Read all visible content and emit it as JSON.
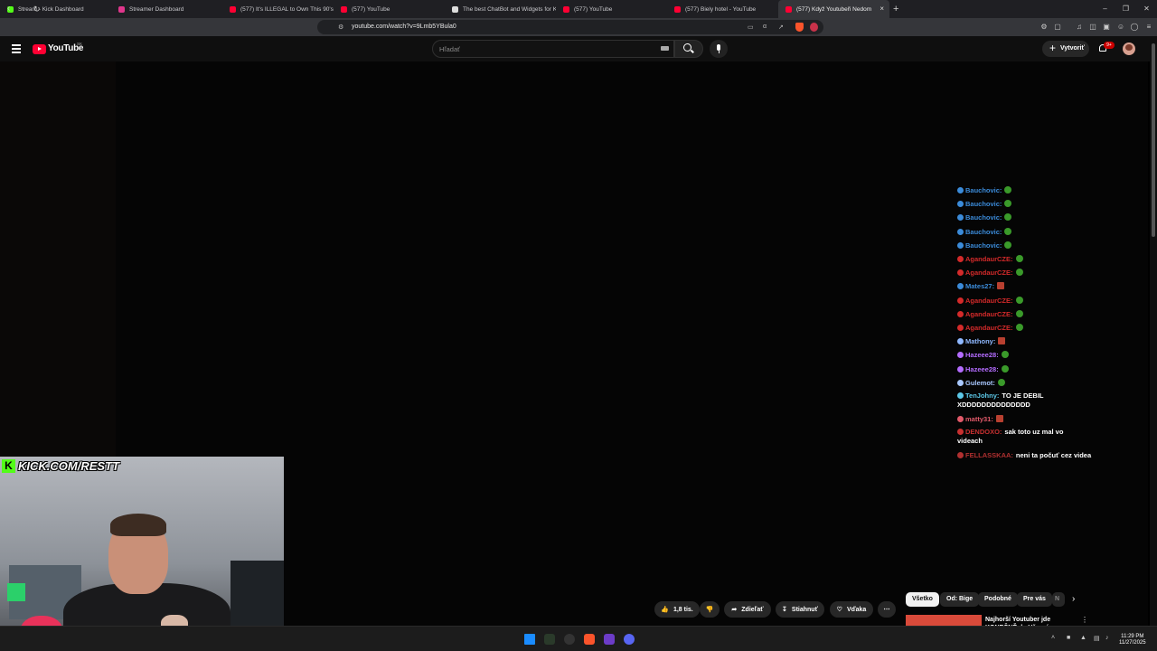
{
  "browser": {
    "tabs": [
      {
        "title": "Stream - Kick Dashboard",
        "color": "#53fc18"
      },
      {
        "title": "Streamer Dashboard",
        "color": "#e0368c"
      },
      {
        "title": "(577) It's ILLEGAL to Own This 90's H",
        "color": "#ff0033"
      },
      {
        "title": "(577) YouTube",
        "color": "#ff0033"
      },
      {
        "title": "The best ChatBot and Widgets for K",
        "color": "#dddddd"
      },
      {
        "title": "(577) YouTube",
        "color": "#ff0033"
      },
      {
        "title": "(577) Biely hotel - YouTube",
        "color": "#ff0033"
      },
      {
        "title": "(577) Když Youtubeři Nedom",
        "color": "#ff0033",
        "active": true
      }
    ],
    "url": "youtube.com/watch?v=9Lmb5YBula0"
  },
  "youtube": {
    "logo_text": "YouTube",
    "country": "SK",
    "search_placeholder": "Hľadať",
    "create_label": "Vytvoriť",
    "notif_count": "9+"
  },
  "chat": [
    {
      "user": "Bauchovic:",
      "color": "#3b8bd9",
      "text": "",
      "emote": true
    },
    {
      "user": "Bauchovic:",
      "color": "#3b8bd9",
      "text": "",
      "emote": true
    },
    {
      "user": "Bauchovic:",
      "color": "#3b8bd9",
      "text": "",
      "emote": true
    },
    {
      "user": "Bauchovic:",
      "color": "#3b8bd9",
      "text": "",
      "emote": true
    },
    {
      "user": "Bauchovic:",
      "color": "#3b8bd9",
      "text": "",
      "emote": true
    },
    {
      "user": "AgandaurCZE:",
      "color": "#d42a2a",
      "text": "",
      "emote": true
    },
    {
      "user": "AgandaurCZE:",
      "color": "#d42a2a",
      "text": "",
      "emote": true
    },
    {
      "user": "Mates27:",
      "color": "#3b8bd9",
      "text": "",
      "emote": true
    },
    {
      "user": "AgandaurCZE:",
      "color": "#d42a2a",
      "text": "",
      "emote": true
    },
    {
      "user": "AgandaurCZE:",
      "color": "#d42a2a",
      "text": "",
      "emote": true
    },
    {
      "user": "AgandaurCZE:",
      "color": "#d42a2a",
      "text": "",
      "emote": true
    },
    {
      "user": "Mathony:",
      "color": "#8fb8ff",
      "text": "",
      "emote": true
    },
    {
      "user": "Hazeee28:",
      "color": "#b46cff",
      "text": "",
      "emote": true
    },
    {
      "user": "Hazeee28:",
      "color": "#b46cff",
      "text": "",
      "emote": true
    },
    {
      "user": "Gulemot:",
      "color": "#a9c8ff",
      "text": "",
      "emote": true
    },
    {
      "user": "TenJohny:",
      "color": "#5cc8e8",
      "text": "TO JE DEBIL XDDDDDDDDDDDDDD",
      "emote": false
    },
    {
      "user": "matty31:",
      "color": "#e25a6a",
      "text": "",
      "emote": true
    },
    {
      "user": "DENDOXO:",
      "color": "#c83030",
      "text": "sak toto uz mal vo videach",
      "emote": false
    },
    {
      "user": "FELLASSKAA:",
      "color": "#b03030",
      "text": "neni ta počuť cez videa",
      "emote": false
    }
  ],
  "webcam": {
    "label": "KICK.COM/RESTT"
  },
  "actions": {
    "likes": "1,8 tis.",
    "share": "Zdieľať",
    "download": "Stiahnuť",
    "thanks": "Vďaka"
  },
  "chips": [
    "Všetko",
    "Od: Bige",
    "Podobné",
    "Pre vás",
    "N"
  ],
  "recommended": {
    "title": "Najhorší Youtuber jde KONEČNĚ do Vězení"
  },
  "taskbar": {
    "time": "11:29 PM",
    "date": "11/27/2025"
  }
}
